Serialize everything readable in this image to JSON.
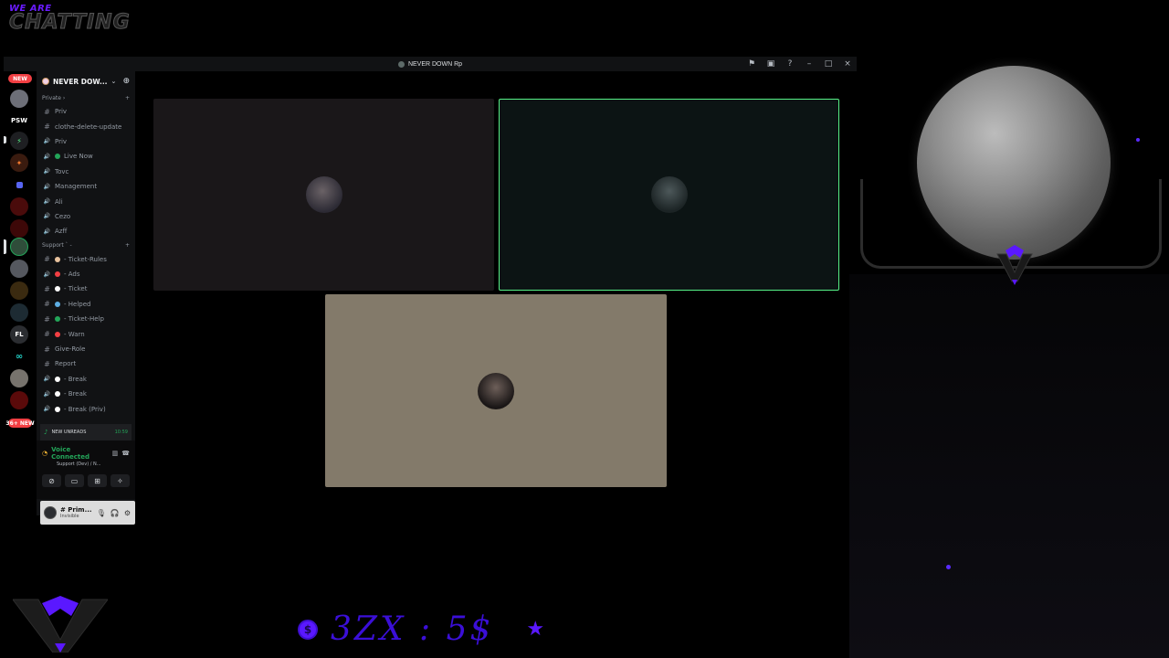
{
  "overlay": {
    "brand_small": "WE ARE",
    "brand_big": "CHATTING",
    "price_text": "3ZX : 5$",
    "coin_symbol": "$",
    "colors": {
      "accent": "#5a18ff",
      "speaking": "#57f287"
    }
  },
  "window": {
    "title": "NEVER DOWN Rp",
    "title_icons": [
      "flag-icon",
      "inbox-icon",
      "help-icon",
      "minimize-icon",
      "maximize-icon",
      "close-icon"
    ]
  },
  "rail": {
    "top_badge": "NEW",
    "psw_label": "PSW",
    "fl_label": "FL",
    "bottom_badge": "NEW",
    "bottom_count": "36+"
  },
  "sidebar": {
    "guild_name": "NEVER DOW...",
    "categories": [
      {
        "label": "Private ›",
        "channels": [
          {
            "type": "text",
            "label": "Priv"
          },
          {
            "type": "text",
            "label": "clothe-delete-update"
          },
          {
            "type": "voice",
            "label": "Priv"
          },
          {
            "type": "voice",
            "label": "Live Now",
            "emoji_color": "#23a559"
          },
          {
            "type": "voice",
            "label": "Tovc"
          },
          {
            "type": "voice",
            "label": "Management"
          },
          {
            "type": "voice",
            "label": "Ali"
          },
          {
            "type": "voice",
            "label": "Cezo"
          },
          {
            "type": "voice",
            "label": "Azff"
          }
        ]
      },
      {
        "label": "Support ` -",
        "channels": [
          {
            "type": "text",
            "label": "- Ticket-Rules",
            "emoji_color": "#e8c39e"
          },
          {
            "type": "voice",
            "label": "- Ads",
            "emoji_color": "#f23f43"
          },
          {
            "type": "text",
            "label": "- Ticket",
            "emoji_color": "#ffffff"
          },
          {
            "type": "text",
            "label": "- Helped",
            "emoji_color": "#5dade2"
          },
          {
            "type": "text",
            "label": "- Ticket-Help",
            "emoji_color": "#23a559"
          },
          {
            "type": "text",
            "label": "- Warn",
            "emoji_color": "#f23f43"
          },
          {
            "type": "text",
            "label": "Give-Role"
          },
          {
            "type": "text",
            "label": "Report"
          },
          {
            "type": "voice",
            "label": "- Break",
            "emoji_color": "#ffffff"
          },
          {
            "type": "voice",
            "label": "- Break",
            "emoji_color": "#ffffff"
          },
          {
            "type": "voice",
            "label": "- Break (Priv)",
            "emoji_color": "#ffffff"
          }
        ]
      }
    ],
    "unreads_label": "NEW UNREADS",
    "unreads_time": "10:59",
    "voice": {
      "title": "Voice Connected",
      "subtitle": "Support (Dev) / N..."
    },
    "user": {
      "name": "# Prim...",
      "status": "Invisible"
    }
  }
}
